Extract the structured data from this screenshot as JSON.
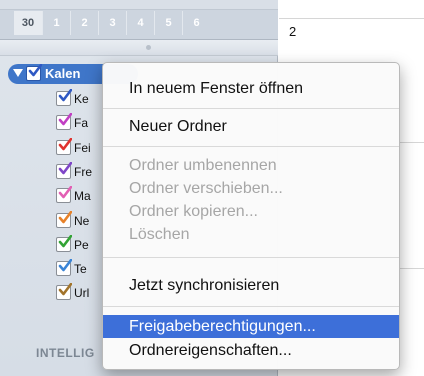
{
  "mini_calendar": {
    "days": [
      "30",
      "1",
      "2",
      "3",
      "4",
      "5",
      "6"
    ]
  },
  "sidebar": {
    "root": {
      "label": "Kalen",
      "checked": true
    },
    "calendars": [
      {
        "label": "Ke",
        "color": "#2f59c4"
      },
      {
        "label": "Fa",
        "color": "#c13fc3"
      },
      {
        "label": "Fei",
        "color": "#e0332f"
      },
      {
        "label": "Fre",
        "color": "#7f46c8"
      },
      {
        "label": "Ma",
        "color": "#e25fb4"
      },
      {
        "label": "Ne",
        "color": "#e7822a"
      },
      {
        "label": "Pe",
        "color": "#33a436"
      },
      {
        "label": "Te",
        "color": "#3a84d6"
      },
      {
        "label": "Url",
        "color": "#a2742b"
      }
    ],
    "section_label": "INTELLIG"
  },
  "content": {
    "day_number": "2"
  },
  "context_menu": {
    "items": [
      {
        "label": "In neuem Fenster öffnen",
        "enabled": true
      },
      {
        "label": "Neuer Ordner",
        "enabled": true
      },
      {
        "label": "Ordner umbenennen",
        "enabled": false
      },
      {
        "label": "Ordner verschieben...",
        "enabled": false
      },
      {
        "label": "Ordner kopieren...",
        "enabled": false
      },
      {
        "label": "Löschen",
        "enabled": false
      },
      {
        "label": "Jetzt synchronisieren",
        "enabled": true
      },
      {
        "label": "Freigabeberechtigungen...",
        "enabled": true,
        "highlighted": true
      },
      {
        "label": "Ordnereigenschaften...",
        "enabled": true
      }
    ]
  },
  "colors": {
    "selection": "#3d6fd9",
    "sidebar_selection": "#3f76c9"
  }
}
